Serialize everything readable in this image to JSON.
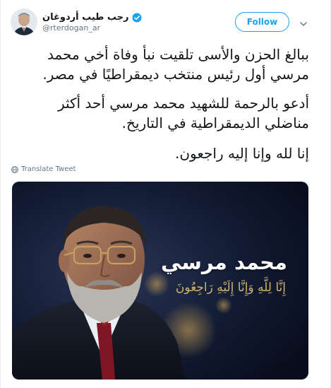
{
  "user": {
    "display_name": "رجب طيب أردوغان",
    "handle": "@rterdogan_ar"
  },
  "follow_label": "Follow",
  "tweet": {
    "paragraph1": "ببالغ الحزن والأسى تلقيت نبأ وفاة أخي محمد مرسي أول رئيس منتخب ديمقراطيًا في مصر.",
    "paragraph2": "أدعو بالرحمة للشهيد محمد مرسي أحد أكثر مناضلي الديمقراطية في التاريخ.",
    "paragraph3": "إنا لله وإنا إليه راجعون."
  },
  "translate_label": "Translate Tweet",
  "media": {
    "title": "محمد مرسي",
    "subtitle": "إِنَّا لِلَّهِ وَإِنَّا إِلَيْهِ رَاجِعُونَ"
  },
  "colors": {
    "accent": "#1da1f2",
    "text": "#14171a",
    "muted": "#657786",
    "media_bg": "#0b1428",
    "media_subtitle": "#d4b16a"
  },
  "icons": [
    "verified-badge-icon",
    "chevron-down-icon",
    "globe-icon"
  ]
}
